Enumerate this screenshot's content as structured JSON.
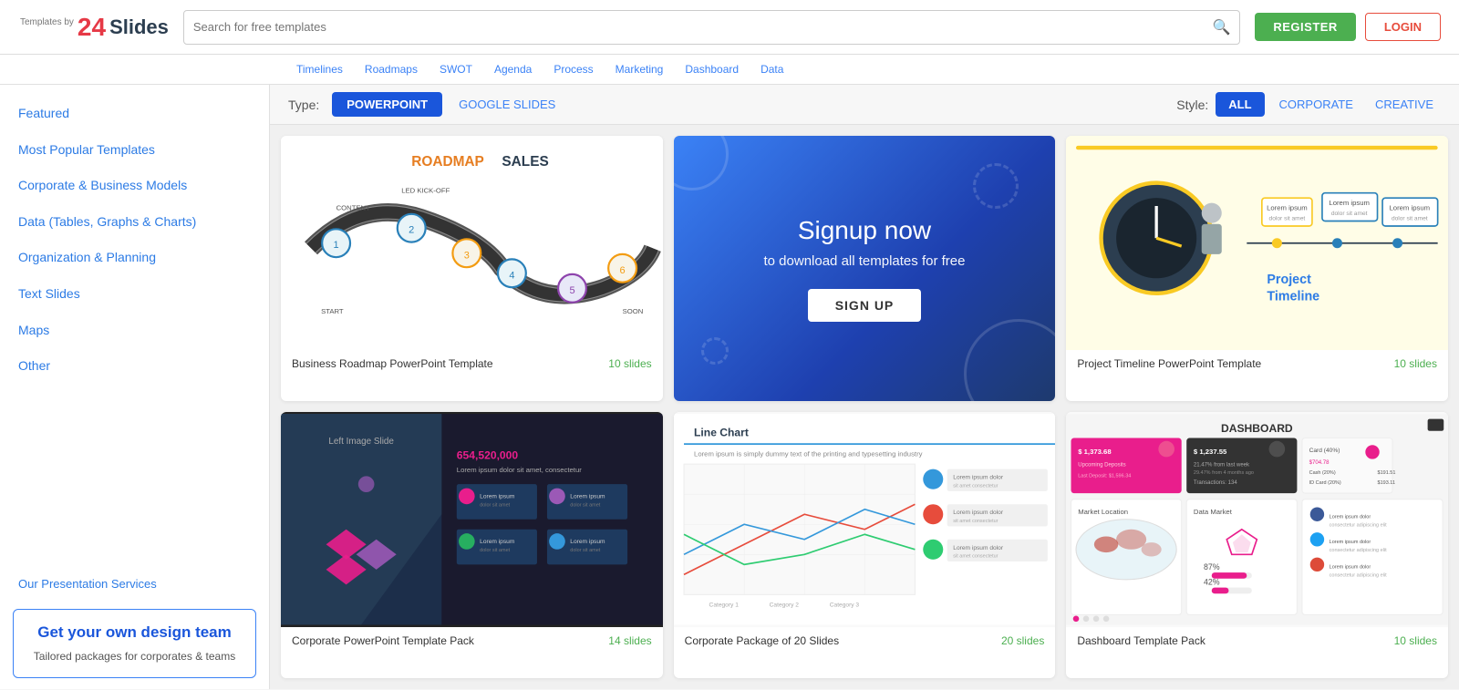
{
  "logo": {
    "number": "24",
    "text": "Slides",
    "sub": "Templates by"
  },
  "search": {
    "placeholder": "Search for free templates"
  },
  "header_buttons": {
    "register": "REGISTER",
    "login": "LOGIN"
  },
  "filter_tags": [
    "Timelines",
    "Roadmaps",
    "SWOT",
    "Agenda",
    "Process",
    "Marketing",
    "Dashboard",
    "Data"
  ],
  "type_bar": {
    "label": "Type:",
    "options": [
      "POWERPOINT",
      "GOOGLE SLIDES"
    ],
    "active": "POWERPOINT"
  },
  "style_bar": {
    "label": "Style:",
    "options": [
      "ALL",
      "CORPORATE",
      "CREATIVE"
    ],
    "active": "ALL"
  },
  "sidebar": {
    "items": [
      {
        "label": "Featured",
        "type": "link"
      },
      {
        "label": "Most Popular Templates",
        "type": "link"
      },
      {
        "label": "Corporate & Business Models",
        "type": "link"
      },
      {
        "label": "Data (Tables, Graphs & Charts)",
        "type": "link"
      },
      {
        "label": "Organization & Planning",
        "type": "link"
      },
      {
        "label": "Text Slides",
        "type": "link"
      },
      {
        "label": "Maps",
        "type": "link"
      },
      {
        "label": "Other",
        "type": "link"
      }
    ],
    "services_label": "Our Presentation Services",
    "promo": {
      "title": "Get your own design team",
      "subtitle": "Tailored packages for corporates & teams"
    }
  },
  "templates": [
    {
      "id": "roadmap",
      "title": "Business Roadmap PowerPoint Template",
      "slides": "10 slides",
      "color": "#fff",
      "bg": "#fff"
    },
    {
      "id": "signup",
      "title": "Signup now",
      "subtitle": "to download all templates for free",
      "cta": "SIGN UP"
    },
    {
      "id": "timeline",
      "title": "Project Timeline PowerPoint Template",
      "slides": "10 slides"
    },
    {
      "id": "corporate-pack",
      "title": "Corporate PowerPoint Template Pack",
      "slides": "14 slides"
    },
    {
      "id": "corporate-package",
      "title": "Corporate Package of 20 Slides",
      "slides": "20 slides"
    },
    {
      "id": "dashboard",
      "title": "Dashboard Template Pack",
      "slides": "10 slides"
    }
  ]
}
